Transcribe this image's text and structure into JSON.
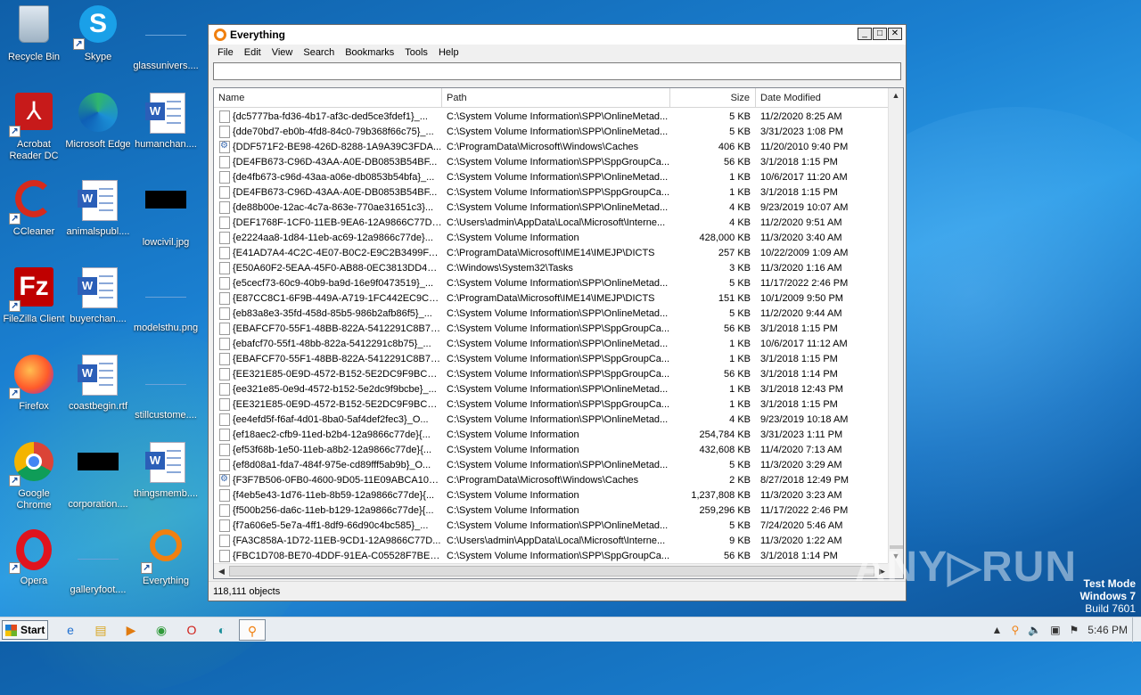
{
  "desktop": {
    "icons": [
      {
        "label": "Recycle Bin",
        "icon": "recycle-bin-icon"
      },
      {
        "label": "Skype",
        "icon": "skype-icon"
      },
      {
        "label": "glassunivers....",
        "icon": "blank-file-icon"
      },
      {
        "label": "Acrobat\nReader DC",
        "icon": "acrobat-icon"
      },
      {
        "label": "Microsoft Edge",
        "icon": "edge-icon"
      },
      {
        "label": "humanchan....",
        "icon": "word-doc-icon"
      },
      {
        "label": "CCleaner",
        "icon": "ccleaner-icon"
      },
      {
        "label": "animalspubl....",
        "icon": "word-doc-icon"
      },
      {
        "label": "lowcivil.jpg",
        "icon": "image-thumb-icon"
      },
      {
        "label": "FileZilla Client",
        "icon": "filezilla-icon"
      },
      {
        "label": "buyerchan....",
        "icon": "word-doc-icon"
      },
      {
        "label": "modelsthu.png",
        "icon": "blank-file-icon"
      },
      {
        "label": "Firefox",
        "icon": "firefox-icon"
      },
      {
        "label": "coastbegin.rtf",
        "icon": "word-doc-icon"
      },
      {
        "label": "stillcustome....",
        "icon": "blank-file-icon"
      },
      {
        "label": "Google\nChrome",
        "icon": "chrome-icon"
      },
      {
        "label": "corporation....",
        "icon": "image-thumb-icon"
      },
      {
        "label": "thingsmemb....",
        "icon": "word-doc-icon"
      },
      {
        "label": "Opera",
        "icon": "opera-icon"
      },
      {
        "label": "galleryfoot....",
        "icon": "blank-file-icon"
      },
      {
        "label": "Everything",
        "icon": "everything-icon"
      }
    ]
  },
  "window": {
    "title": "Everything",
    "menu": [
      "File",
      "Edit",
      "View",
      "Search",
      "Bookmarks",
      "Tools",
      "Help"
    ],
    "search_value": "",
    "columns": {
      "name": "Name",
      "path": "Path",
      "size": "Size",
      "date": "Date Modified"
    },
    "rows": [
      {
        "name": "{dc5777ba-fd36-4b17-af3c-ded5ce3fdef1}_...",
        "path": "C:\\System Volume Information\\SPP\\OnlineMetad...",
        "size": "5 KB",
        "date": "11/2/2020 8:25 AM",
        "icon": "file"
      },
      {
        "name": "{dde70bd7-eb0b-4fd8-84c0-79b368f66c75}_...",
        "path": "C:\\System Volume Information\\SPP\\OnlineMetad...",
        "size": "5 KB",
        "date": "3/31/2023 1:08 PM",
        "icon": "file"
      },
      {
        "name": "{DDF571F2-BE98-426D-8288-1A9A39C3FDA...",
        "path": "C:\\ProgramData\\Microsoft\\Windows\\Caches",
        "size": "406 KB",
        "date": "11/20/2010 9:40 PM",
        "icon": "sys"
      },
      {
        "name": "{DE4FB673-C96D-43AA-A0E-DB0853B54BF...",
        "path": "C:\\System Volume Information\\SPP\\SppGroupCa...",
        "size": "56 KB",
        "date": "3/1/2018 1:15 PM",
        "icon": "file"
      },
      {
        "name": "{de4fb673-c96d-43aa-a06e-db0853b54bfa}_...",
        "path": "C:\\System Volume Information\\SPP\\OnlineMetad...",
        "size": "1 KB",
        "date": "10/6/2017 11:20 AM",
        "icon": "file"
      },
      {
        "name": "{DE4FB673-C96D-43AA-A0E-DB0853B54BF...",
        "path": "C:\\System Volume Information\\SPP\\SppGroupCa...",
        "size": "1 KB",
        "date": "3/1/2018 1:15 PM",
        "icon": "file"
      },
      {
        "name": "{de88b00e-12ac-4c7a-863e-770ae31651c3}...",
        "path": "C:\\System Volume Information\\SPP\\OnlineMetad...",
        "size": "4 KB",
        "date": "9/23/2019 10:07 AM",
        "icon": "file"
      },
      {
        "name": "{DEF1768F-1CF0-11EB-9EA6-12A9866C77DE...",
        "path": "C:\\Users\\admin\\AppData\\Local\\Microsoft\\Interne...",
        "size": "4 KB",
        "date": "11/2/2020 9:51 AM",
        "icon": "file"
      },
      {
        "name": "{e2224aa8-1d84-11eb-ac69-12a9866c77de}...",
        "path": "C:\\System Volume Information",
        "size": "428,000 KB",
        "date": "11/3/2020 3:40 AM",
        "icon": "file"
      },
      {
        "name": "{E41AD7A4-4C2C-4E07-B0C2-E9C2B3499FA...",
        "path": "C:\\ProgramData\\Microsoft\\IME14\\IMEJP\\DICTS",
        "size": "257 KB",
        "date": "10/22/2009 1:09 AM",
        "icon": "file"
      },
      {
        "name": "{E50A60F2-5EAA-45F0-AB88-0EC3813DD4AB}",
        "path": "C:\\Windows\\System32\\Tasks",
        "size": "3 KB",
        "date": "11/3/2020 1:16 AM",
        "icon": "file"
      },
      {
        "name": "{e5cecf73-60c9-40b9-ba9d-16e9f0473519}_...",
        "path": "C:\\System Volume Information\\SPP\\OnlineMetad...",
        "size": "5 KB",
        "date": "11/17/2022 2:46 PM",
        "icon": "file"
      },
      {
        "name": "{E87CC8C1-6F9B-449A-A719-1FC442EC9CB...",
        "path": "C:\\ProgramData\\Microsoft\\IME14\\IMEJP\\DICTS",
        "size": "151 KB",
        "date": "10/1/2009 9:50 PM",
        "icon": "file"
      },
      {
        "name": "{eb83a8e3-35fd-458d-85b5-986b2afb86f5}_...",
        "path": "C:\\System Volume Information\\SPP\\OnlineMetad...",
        "size": "5 KB",
        "date": "11/2/2020 9:44 AM",
        "icon": "file"
      },
      {
        "name": "{EBAFCF70-55F1-48BB-822A-5412291C8B75...",
        "path": "C:\\System Volume Information\\SPP\\SppGroupCa...",
        "size": "56 KB",
        "date": "3/1/2018 1:15 PM",
        "icon": "file"
      },
      {
        "name": "{ebafcf70-55f1-48bb-822a-5412291c8b75}_...",
        "path": "C:\\System Volume Information\\SPP\\OnlineMetad...",
        "size": "1 KB",
        "date": "10/6/2017 11:12 AM",
        "icon": "file"
      },
      {
        "name": "{EBAFCF70-55F1-48BB-822A-5412291C8B75...",
        "path": "C:\\System Volume Information\\SPP\\SppGroupCa...",
        "size": "1 KB",
        "date": "3/1/2018 1:15 PM",
        "icon": "file"
      },
      {
        "name": "{EE321E85-0E9D-4572-B152-5E2DC9F9BCBE...",
        "path": "C:\\System Volume Information\\SPP\\SppGroupCa...",
        "size": "56 KB",
        "date": "3/1/2018 1:14 PM",
        "icon": "file"
      },
      {
        "name": "{ee321e85-0e9d-4572-b152-5e2dc9f9bcbe}_...",
        "path": "C:\\System Volume Information\\SPP\\OnlineMetad...",
        "size": "1 KB",
        "date": "3/1/2018 12:43 PM",
        "icon": "file"
      },
      {
        "name": "{EE321E85-0E9D-4572-B152-5E2DC9F9BCBE...",
        "path": "C:\\System Volume Information\\SPP\\SppGroupCa...",
        "size": "1 KB",
        "date": "3/1/2018 1:15 PM",
        "icon": "file"
      },
      {
        "name": "{ee4efd5f-f6af-4d01-8ba0-5af4def2fec3}_O...",
        "path": "C:\\System Volume Information\\SPP\\OnlineMetad...",
        "size": "4 KB",
        "date": "9/23/2019 10:18 AM",
        "icon": "file"
      },
      {
        "name": "{ef18aec2-cfb9-11ed-b2b4-12a9866c77de}{...",
        "path": "C:\\System Volume Information",
        "size": "254,784 KB",
        "date": "3/31/2023 1:11 PM",
        "icon": "file"
      },
      {
        "name": "{ef53f68b-1e50-11eb-a8b2-12a9866c77de}{...",
        "path": "C:\\System Volume Information",
        "size": "432,608 KB",
        "date": "11/4/2020 7:13 AM",
        "icon": "file"
      },
      {
        "name": "{ef8d08a1-fda7-484f-975e-cd89fff5ab9b}_O...",
        "path": "C:\\System Volume Information\\SPP\\OnlineMetad...",
        "size": "5 KB",
        "date": "11/3/2020 3:29 AM",
        "icon": "file"
      },
      {
        "name": "{F3F7B506-0FB0-4600-9D05-11E09ABCA102...",
        "path": "C:\\ProgramData\\Microsoft\\Windows\\Caches",
        "size": "2 KB",
        "date": "8/27/2018 12:49 PM",
        "icon": "sys"
      },
      {
        "name": "{f4eb5e43-1d76-11eb-8b59-12a9866c77de}{...",
        "path": "C:\\System Volume Information",
        "size": "1,237,808 KB",
        "date": "11/3/2020 3:23 AM",
        "icon": "file"
      },
      {
        "name": "{f500b256-da6c-11eb-b129-12a9866c77de}{...",
        "path": "C:\\System Volume Information",
        "size": "259,296 KB",
        "date": "11/17/2022 2:46 PM",
        "icon": "file"
      },
      {
        "name": "{f7a606e5-5e7a-4ff1-8df9-66d90c4bc585}_...",
        "path": "C:\\System Volume Information\\SPP\\OnlineMetad...",
        "size": "5 KB",
        "date": "7/24/2020 5:46 AM",
        "icon": "file"
      },
      {
        "name": "{FA3C858A-1D72-11EB-9CD1-12A9866C77D...",
        "path": "C:\\Users\\admin\\AppData\\Local\\Microsoft\\Interne...",
        "size": "9 KB",
        "date": "11/3/2020 1:22 AM",
        "icon": "file"
      },
      {
        "name": "{FBC1D708-BE70-4DDF-91EA-C05528F7BECB...",
        "path": "C:\\System Volume Information\\SPP\\SppGroupCa...",
        "size": "56 KB",
        "date": "3/1/2018 1:14 PM",
        "icon": "file"
      }
    ],
    "status": "118,111 objects"
  },
  "watermark": {
    "text": "ANY▷RUN",
    "test_mode": "Test Mode",
    "os": "Windows 7",
    "build": "Build 7601"
  },
  "taskbar": {
    "start_label": "Start",
    "clock": "5:46 PM"
  }
}
